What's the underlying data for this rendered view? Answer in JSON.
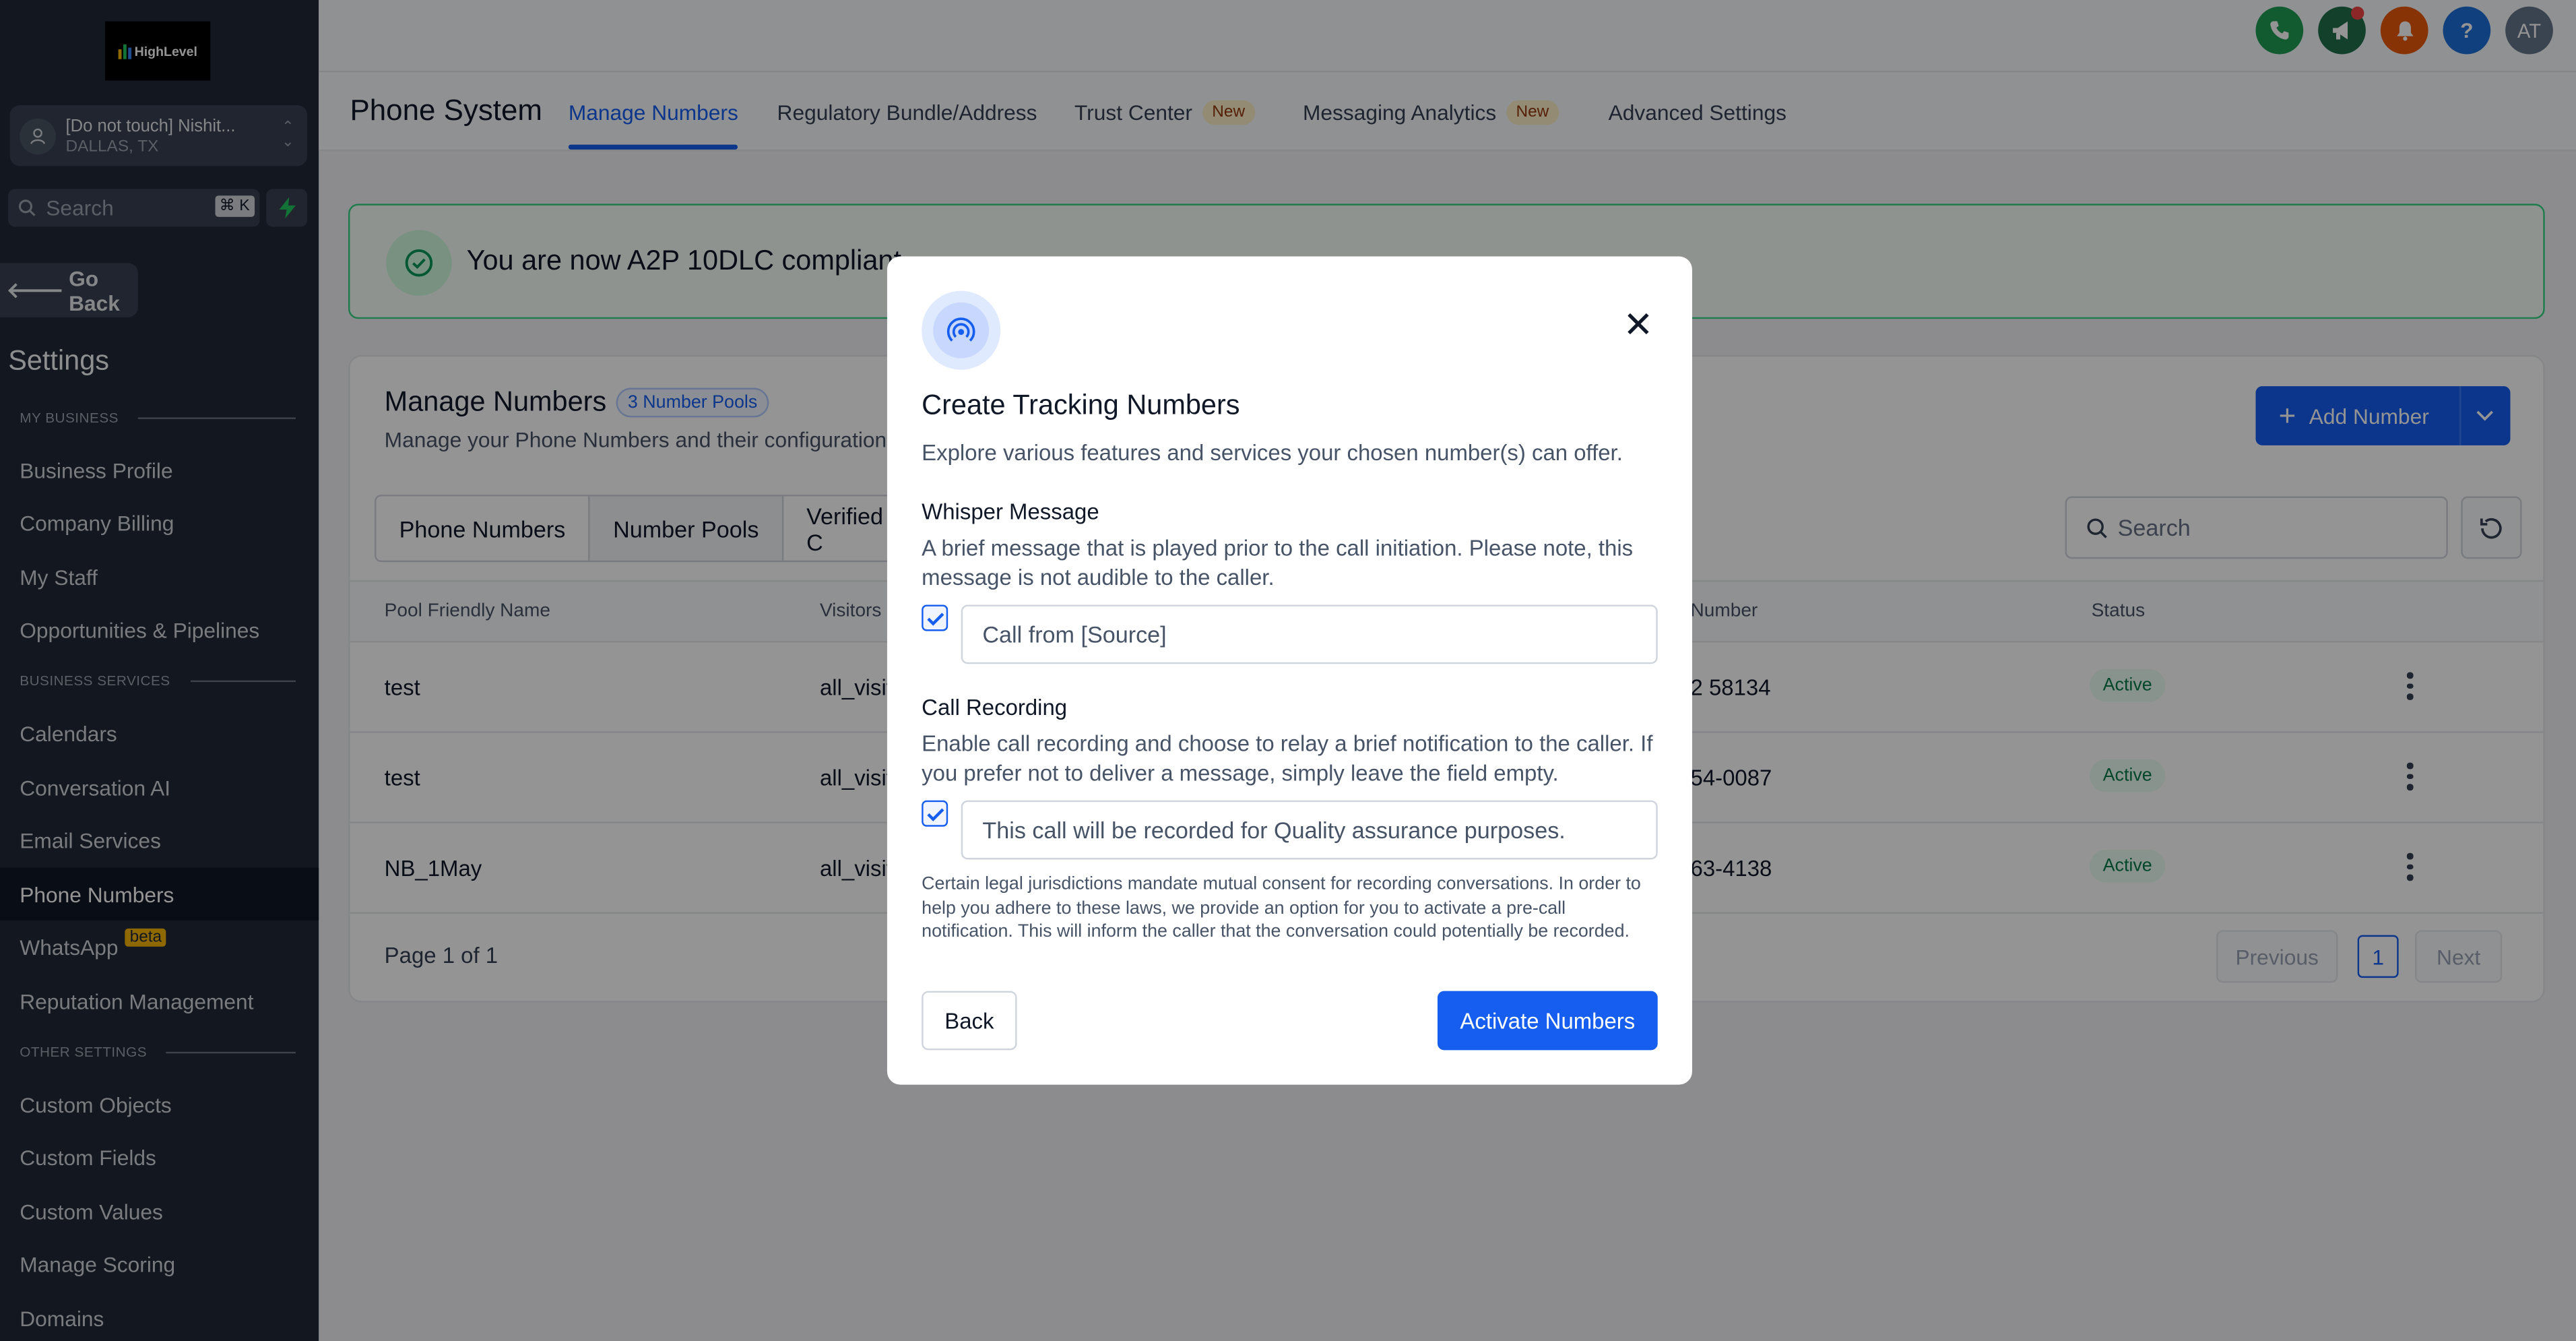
{
  "sidebar": {
    "logo_text": "HighLevel",
    "location_name": "[Do not touch] Nishit...",
    "location_city": "DALLAS, TX",
    "search_placeholder": "Search",
    "search_shortcut": "⌘ K",
    "go_back": "Go Back",
    "settings_title": "Settings",
    "sections": {
      "my_business": "MY BUSINESS",
      "business_services": "BUSINESS SERVICES",
      "other_settings": "OTHER SETTINGS"
    },
    "items": [
      "Business Profile",
      "Company Billing",
      "My Staff",
      "Opportunities & Pipelines",
      "Calendars",
      "Conversation AI",
      "Email Services",
      "Phone Numbers",
      "WhatsApp",
      "Reputation Management",
      "Custom Objects",
      "Custom Fields",
      "Custom Values",
      "Manage Scoring",
      "Domains"
    ],
    "active_item": "Phone Numbers",
    "whatsapp_badge": "beta"
  },
  "topbar": {
    "help_glyph": "?",
    "avatar_initials": "AT",
    "icon_colors": {
      "phone": "#1f9d55",
      "megaphone": "#1f6f4a",
      "bell": "#e8590c",
      "help": "#1d6fd8",
      "avatar": "#64748b"
    }
  },
  "subnav": {
    "title": "Phone System",
    "tabs": [
      {
        "label": "Manage Numbers",
        "active": true
      },
      {
        "label": "Regulatory Bundle/Address"
      },
      {
        "label": "Trust Center",
        "badge": "New"
      },
      {
        "label": "Messaging Analytics",
        "badge": "New"
      },
      {
        "label": "Advanced Settings"
      }
    ]
  },
  "banner": {
    "text": "You are now A2P 10DLC compliant"
  },
  "manage": {
    "title": "Manage Numbers",
    "pools_badge": "3 Number Pools",
    "subtitle": "Manage your Phone Numbers and their configuration",
    "add_button": "Add Number",
    "segments": [
      "Phone Numbers",
      "Number Pools",
      "Verified C"
    ],
    "search_placeholder": "Search",
    "columns": [
      "Pool Friendly Name",
      "Visitors",
      "Number",
      "Status"
    ],
    "rows": [
      {
        "name": "test",
        "visitors": "all_visit",
        "number": "2 58134",
        "status": "Active"
      },
      {
        "name": "test",
        "visitors": "all_visit",
        "number": "54-0087",
        "status": "Active"
      },
      {
        "name": "NB_1May",
        "visitors": "all_visit",
        "number": "63-4138",
        "status": "Active"
      }
    ],
    "page_info": "Page 1 of 1",
    "prev": "Previous",
    "page": "1",
    "next": "Next"
  },
  "modal": {
    "title": "Create Tracking Numbers",
    "description": "Explore various features and services your chosen number(s) can offer.",
    "whisper_label": "Whisper Message",
    "whisper_help": "A brief message that is played prior to the call initiation. Please note, this message is not audible to the caller.",
    "whisper_value": "Call from [Source]",
    "whisper_checked": true,
    "recording_label": "Call Recording",
    "recording_help": "Enable call recording and choose to relay a brief notification to the caller. If you prefer not to deliver a message, simply leave the field empty.",
    "recording_value": "This call will be recorded for Quality assurance purposes.",
    "recording_checked": true,
    "note": "Certain legal jurisdictions mandate mutual consent for recording conversations. In order to help you adhere to these laws, we provide an option for you to activate a pre-call notification. This will inform the caller that the conversation could potentially be recorded.",
    "back": "Back",
    "activate": "Activate Numbers",
    "close_glyph": "✕"
  }
}
